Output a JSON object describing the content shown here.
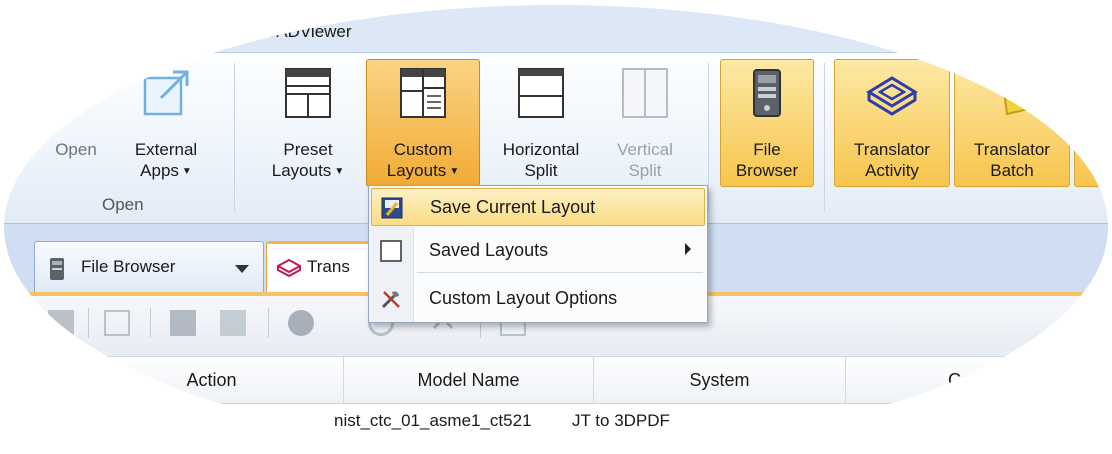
{
  "window": {
    "title": "CADViewer"
  },
  "ribbon": {
    "buttons": [
      {
        "id": "open",
        "label": "Open",
        "label2": "",
        "dropdown": false,
        "state": "normal"
      },
      {
        "id": "external",
        "label": "External",
        "label2": "Apps",
        "dropdown": true,
        "state": "normal"
      },
      {
        "id": "preset",
        "label": "Preset",
        "label2": "Layouts",
        "dropdown": true,
        "state": "normal"
      },
      {
        "id": "custom",
        "label": "Custom",
        "label2": "Layouts",
        "dropdown": true,
        "state": "pressed"
      },
      {
        "id": "hsplit",
        "label": "Horizontal",
        "label2": "Split",
        "dropdown": false,
        "state": "normal"
      },
      {
        "id": "vsplit",
        "label": "Vertical",
        "label2": "Split",
        "dropdown": false,
        "state": "disabled"
      },
      {
        "id": "filebrowser",
        "label": "File",
        "label2": "Browser",
        "dropdown": false,
        "state": "hot"
      },
      {
        "id": "tactivity",
        "label": "Translator",
        "label2": "Activity",
        "dropdown": false,
        "state": "hot"
      },
      {
        "id": "tbatch",
        "label": "Translator",
        "label2": "Batch",
        "dropdown": false,
        "state": "hot"
      }
    ],
    "groups": [
      {
        "name": "Open"
      }
    ]
  },
  "menu": {
    "items": [
      {
        "label": "Save Current Layout",
        "icon": "save-layout-icon",
        "highlighted": true,
        "submenu": false
      },
      {
        "label": "Saved Layouts",
        "icon": "blank-square-icon",
        "highlighted": false,
        "submenu": true
      },
      {
        "label": "Custom Layout Options",
        "icon": "tools-icon",
        "highlighted": false,
        "submenu": false
      }
    ]
  },
  "tabs": [
    {
      "label": "File Browser",
      "icon": "file-browser-icon",
      "active": false
    },
    {
      "label": "Trans",
      "icon": "translator-cube-icon",
      "active": true
    }
  ],
  "grid": {
    "columns": [
      "Action",
      "Model Name",
      "System",
      "Configu"
    ],
    "rows": [
      {
        "model": "nist_ctc_01_asme1_ct521",
        "system": "JT to 3DPDF"
      }
    ]
  },
  "colors": {
    "accent": "#f7c54d",
    "highlight": "#f9dc84",
    "ribbon": "#eef4fb",
    "tabstrip": "#cfdef2"
  }
}
